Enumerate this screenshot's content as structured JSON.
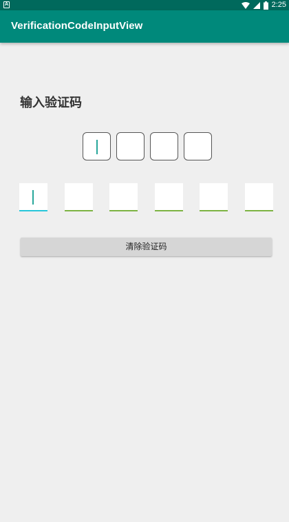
{
  "status_bar": {
    "notification_icon": "a-icon",
    "icons": [
      "wifi-icon",
      "signal-icon",
      "battery-icon"
    ],
    "time": "2:25"
  },
  "app_bar": {
    "title": "VerificationCodeInputView"
  },
  "main": {
    "heading": "输入验证码",
    "box_code": {
      "values": [
        "",
        "",
        "",
        ""
      ],
      "active_index": 0
    },
    "line_code": {
      "values": [
        "",
        "",
        "",
        "",
        "",
        ""
      ],
      "active_index": 0
    },
    "clear_button_label": "清除验证码"
  },
  "colors": {
    "status_bar": "#00695c",
    "app_bar": "#00897b",
    "cursor": "#26a69a",
    "active_underline": "#26c6da",
    "underline": "#7cb342"
  }
}
